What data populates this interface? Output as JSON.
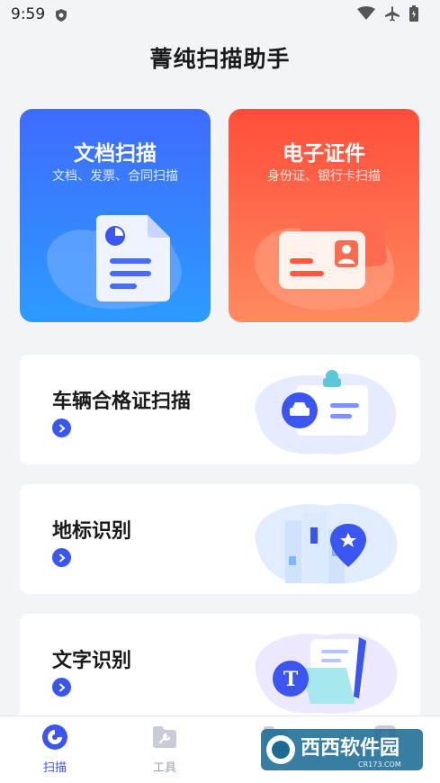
{
  "status_bar": {
    "time": "9:59"
  },
  "app_title": "菁纯扫描助手",
  "cards": {
    "document": {
      "title": "文档扫描",
      "subtitle": "文档、发票、合同扫描"
    },
    "id": {
      "title": "电子证件",
      "subtitle": "身份证、银行卡扫描"
    }
  },
  "rows": [
    {
      "label": "车辆合格证扫描"
    },
    {
      "label": "地标识别"
    },
    {
      "label": "文字识别"
    }
  ],
  "nav": [
    {
      "label": "扫描",
      "active": true
    },
    {
      "label": "工具",
      "active": false
    },
    {
      "label": "",
      "active": false
    },
    {
      "label": "",
      "active": false
    }
  ],
  "watermark": {
    "text": "西西软件园",
    "sub": "CR173.COM"
  },
  "colors": {
    "accent": "#3a55f0",
    "doc_card": "#3f6bff",
    "id_card": "#ff5a3d"
  }
}
